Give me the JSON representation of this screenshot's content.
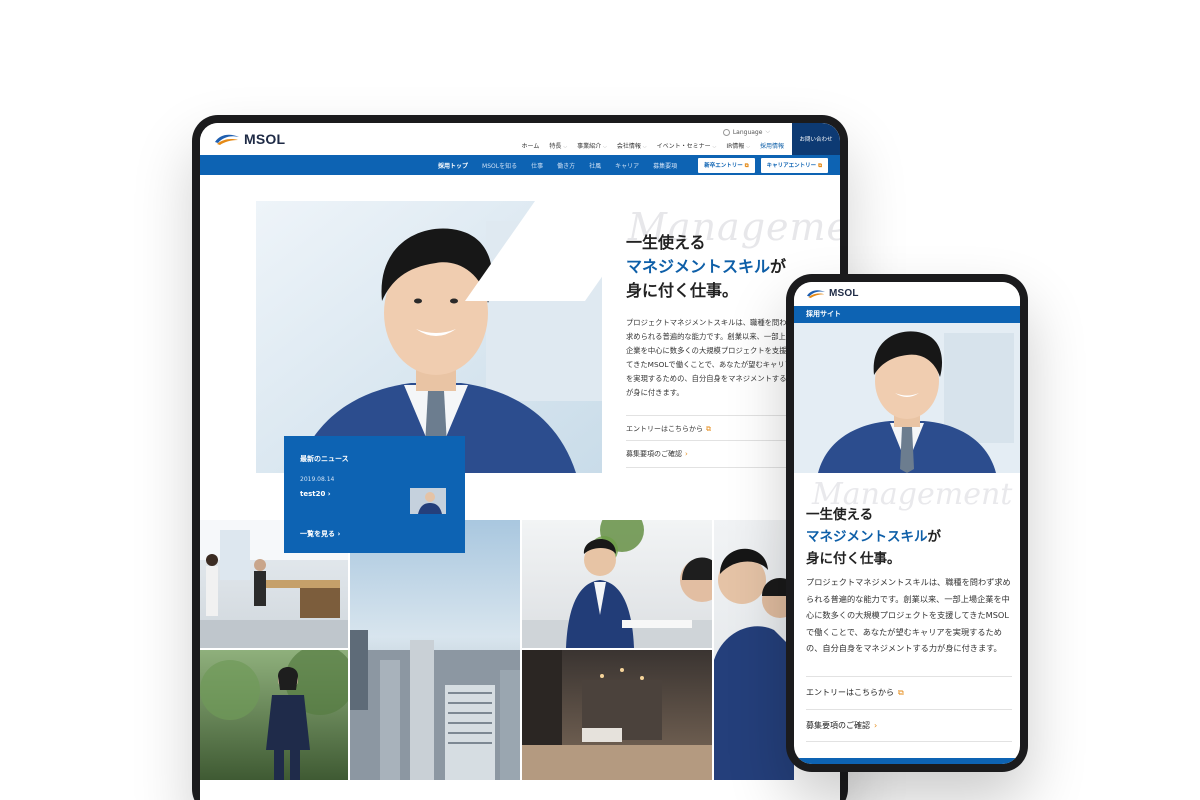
{
  "tablet": {
    "brand": "MSOL",
    "language": "Language",
    "nav": [
      "ホーム",
      "特長",
      "事業紹介",
      "会社情報",
      "イベント・セミナー",
      "IR情報",
      "採用情報"
    ],
    "contact": "お問い合わせ",
    "subnav": [
      "採用トップ",
      "MSOLを知る",
      "仕事",
      "働き方",
      "社風",
      "キャリア",
      "募集要項"
    ],
    "entry_new": "新卒エントリー",
    "entry_career": "キャリアエントリー",
    "deco": "Management",
    "copy_line1": "一生使える",
    "copy_line2_blue": "マネジメントスキル",
    "copy_line2_rest": "が",
    "copy_line3": "身に付く仕事。",
    "desc": "プロジェクトマネジメントスキルは、職種を問わず求められる普遍的な能力です。創業以来、一部上場企業を中心に数多くの大規模プロジェクトを支援してきたMSOLで働くことで、あなたが望むキャリアを実現するための、自分自身をマネジメントする力が身に付きます。",
    "link_entry": "エントリーはこちらから",
    "link_recruit": "募集要項のご確認",
    "news": {
      "heading": "最新のニュース",
      "date": "2019.08.14",
      "title": "test20",
      "more": "一覧を見る"
    }
  },
  "phone": {
    "brand": "MSOL",
    "bar": "採用サイト",
    "deco": "Management",
    "copy_line1": "一生使える",
    "copy_line2_blue": "マネジメントスキル",
    "copy_line2_rest": "が",
    "copy_line3": "身に付く仕事。",
    "desc": "プロジェクトマネジメントスキルは、職種を問わず求められる普遍的な能力です。創業以来、一部上場企業を中心に数多くの大規模プロジェクトを支援してきたMSOLで働くことで、あなたが望むキャリアを実現するための、自分自身をマネジメントする力が身に付きます。",
    "link_entry": "エントリーはこちらから",
    "link_recruit": "募集要項のご確認"
  },
  "colors": {
    "brand_blue": "#0d63b3",
    "navy": "#0d3a73",
    "accent_orange": "#e58a16"
  }
}
